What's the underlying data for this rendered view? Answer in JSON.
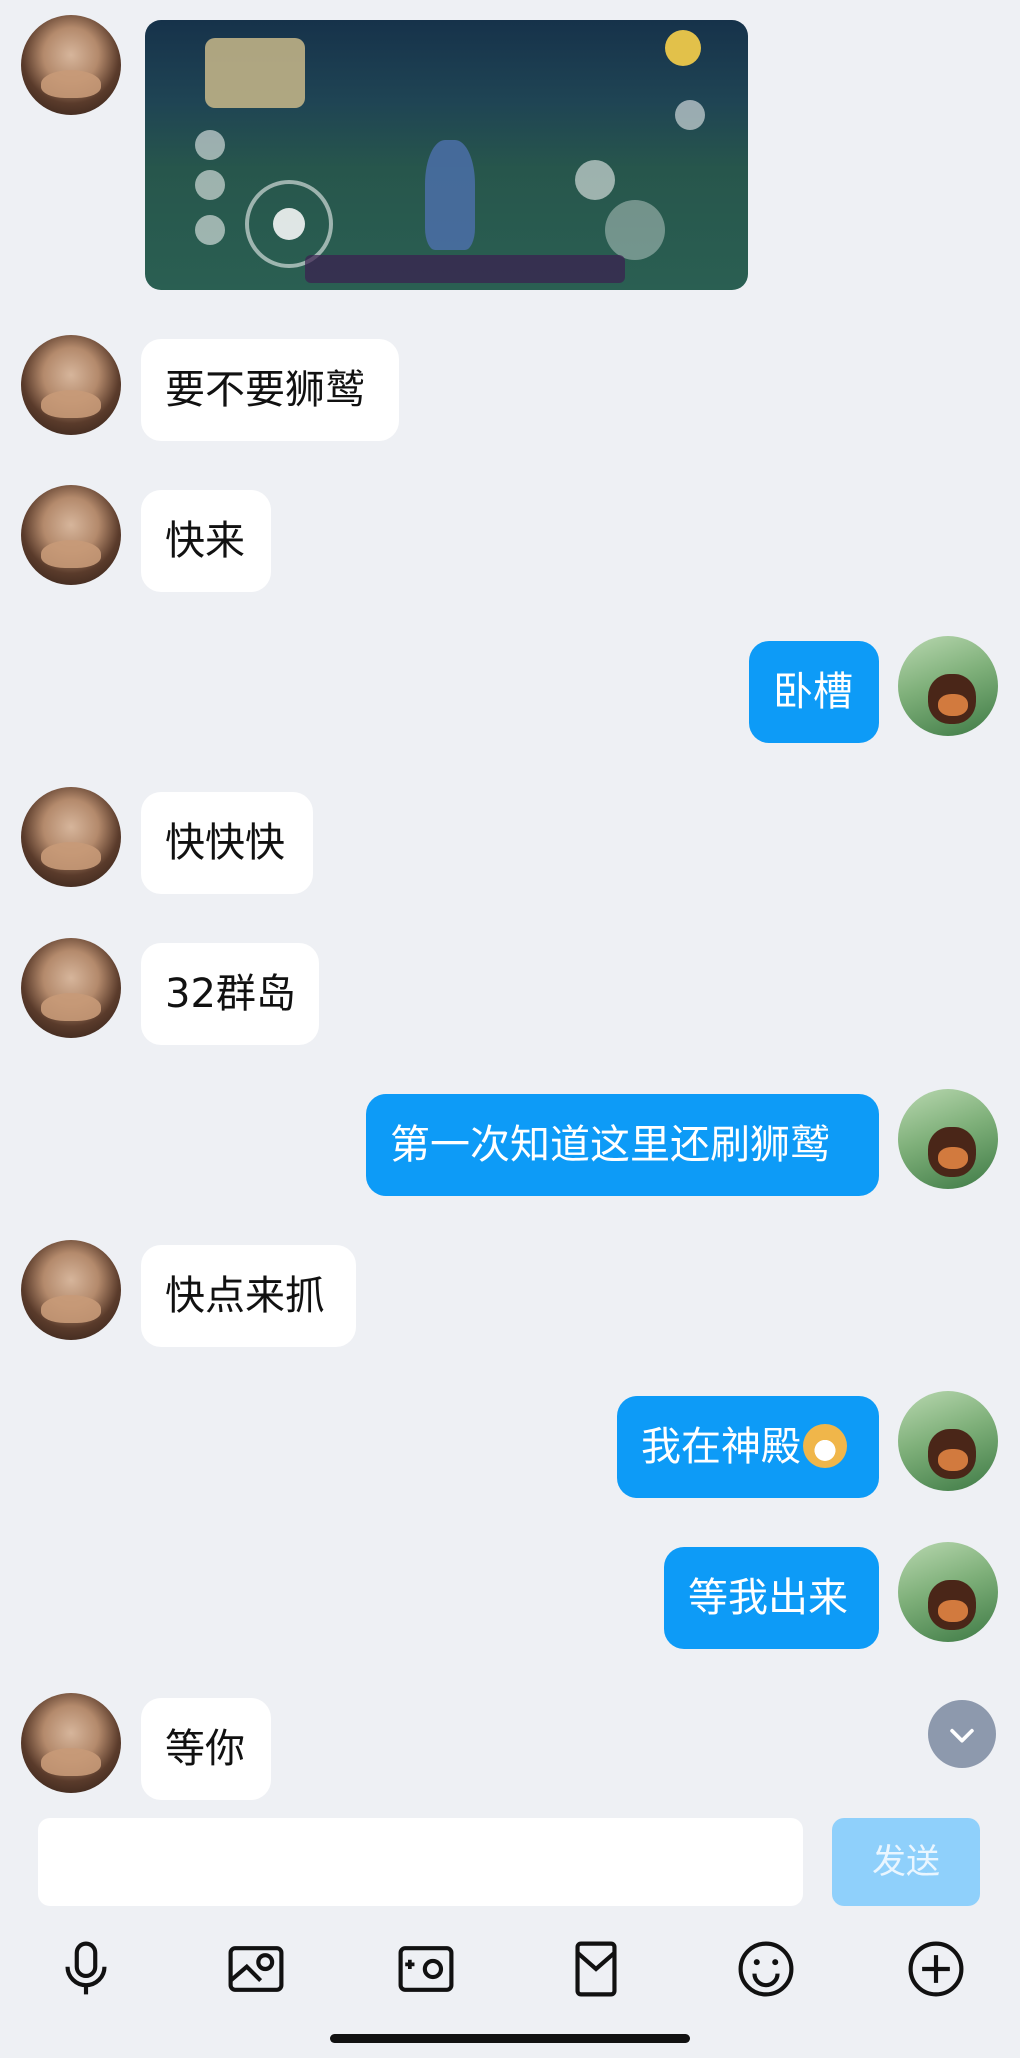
{
  "chat": {
    "messages": [
      {
        "side": "left",
        "type": "image"
      },
      {
        "side": "left",
        "text": "要不要狮鹫"
      },
      {
        "side": "left",
        "text": "快来"
      },
      {
        "side": "right",
        "text": "卧槽"
      },
      {
        "side": "left",
        "text": "快快快"
      },
      {
        "side": "left",
        "text": "32群岛"
      },
      {
        "side": "right",
        "text": "第一次知道这里还刷狮鹫"
      },
      {
        "side": "left",
        "text": "快点来抓"
      },
      {
        "side": "right",
        "text": "我在神殿",
        "emoji": "bear-face-emoji"
      },
      {
        "side": "right",
        "text": "等我出来"
      },
      {
        "side": "left",
        "text": "等你"
      }
    ]
  },
  "composer": {
    "placeholder": "",
    "send_label": "发送"
  },
  "toolbar": {
    "icons": [
      "microphone-icon",
      "image-icon",
      "camera-icon",
      "red-packet-icon",
      "smiley-icon",
      "plus-icon"
    ]
  },
  "colors": {
    "background": "#eef0f4",
    "incoming_bubble": "#ffffff",
    "outgoing_bubble": "#0d9bf7",
    "send_button_disabled": "#8fd0fb"
  }
}
